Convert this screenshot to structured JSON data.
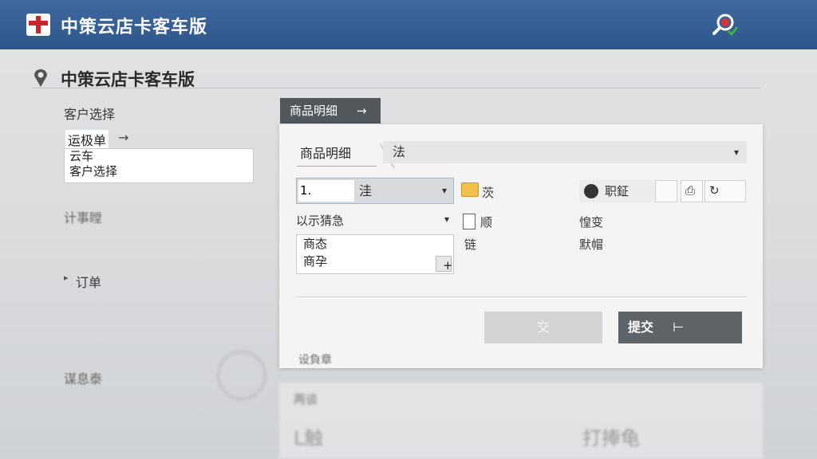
{
  "app": {
    "title": "中策云店卡客车版"
  },
  "page": {
    "heading": "中策云店卡客车版"
  },
  "sidebar": {
    "customer_select_label": "客户选择",
    "customer_chip": "运极单",
    "customer_chip_arrow": "→",
    "customer_list": [
      "云车",
      "客户选择"
    ],
    "blurred_item_1": "计事瞠",
    "order_marker": "▸",
    "order_label": "订单",
    "blurred_item_2": "谋息泰"
  },
  "tab": {
    "label": "商品明细",
    "arrow": "→"
  },
  "panel": {
    "subtab_label": "商品明细",
    "top_select_value": "法",
    "quantity_value": "1.",
    "quantity_unit": "洼",
    "folder_label": "茨",
    "pill_label": "职鉦",
    "dropdown_label": "以示猜急",
    "doc_label": "顺",
    "doc_label2": "链",
    "right_label_1": "惶变",
    "right_label_2": "默帽",
    "list_items": [
      "商态",
      "商孕"
    ],
    "plus_label": "+",
    "disabled_button_label": "交",
    "submit_button_label": "提交",
    "submit_arrow": "⊢",
    "footer_note": "设負章"
  },
  "ghost": {
    "label": "两谈",
    "value_left": "L触",
    "value_right": "打捧龟"
  },
  "icons": {
    "logo": "app-logo-icon",
    "search": "magnifier-icon",
    "pin": "location-pin-icon",
    "folder": "folder-icon",
    "document": "document-icon",
    "moon": "moon-icon",
    "printer": "printer-icon",
    "refresh": "refresh-icon"
  },
  "colors": {
    "titlebar": "#2e5689",
    "submit": "#5e6368",
    "tab": "#52575c",
    "logo_red": "#c62828"
  }
}
